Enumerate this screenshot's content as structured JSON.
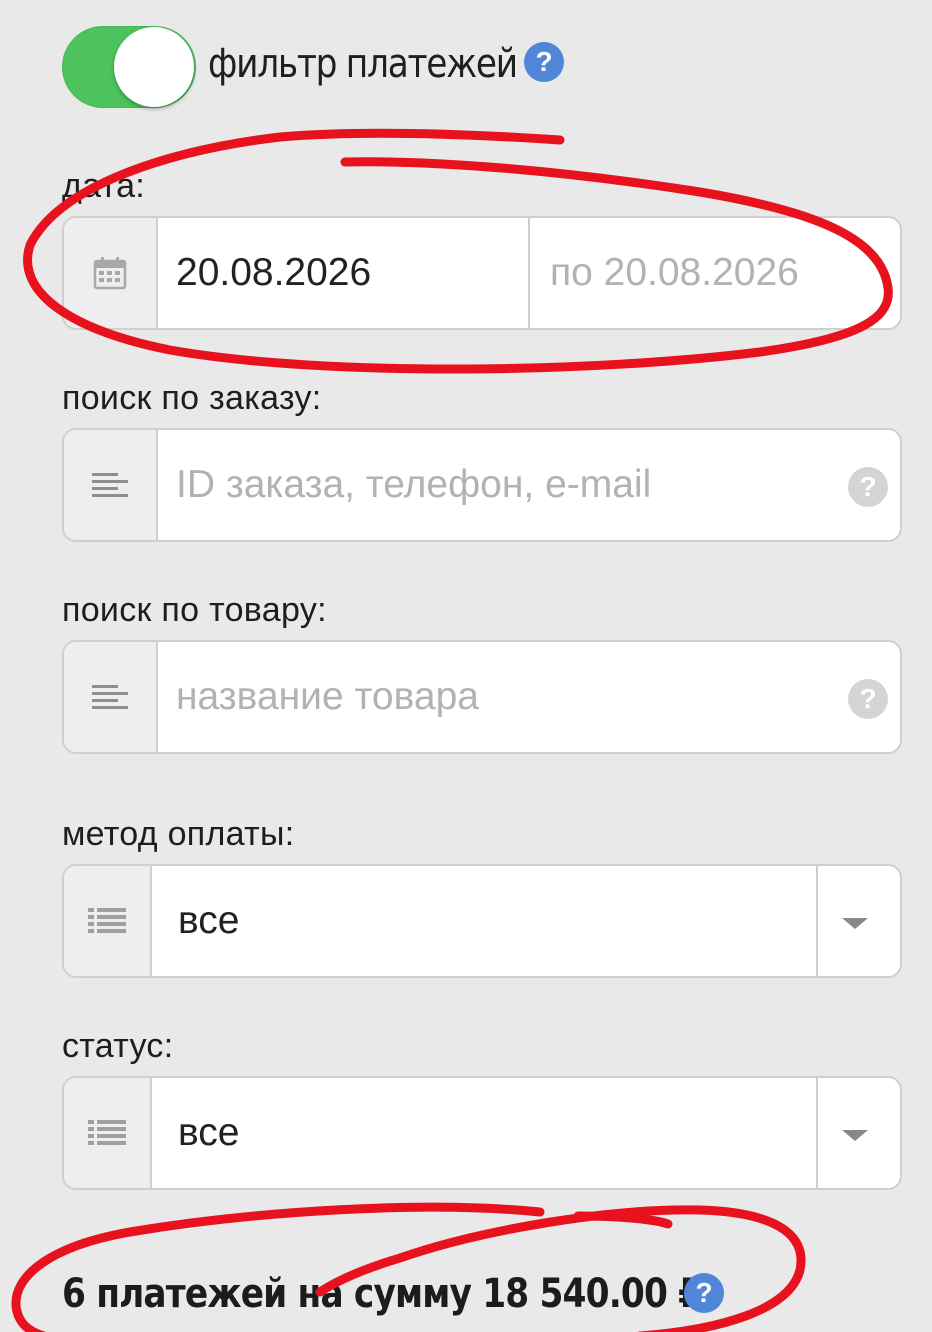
{
  "filter": {
    "title": "фильтр платежей",
    "enabled": true,
    "help_glyph": "?"
  },
  "date": {
    "label": "дата:",
    "icon": "calendar-icon",
    "from_value": "20.08.2026",
    "to_placeholder": "по 20.08.2026"
  },
  "order_search": {
    "label": "поиск по заказу:",
    "icon": "text-lines-icon",
    "placeholder": "ID заказа, телефон, e-mail",
    "help_glyph": "?"
  },
  "product_search": {
    "label": "поиск по товару:",
    "icon": "text-lines-icon",
    "placeholder": "название товара",
    "help_glyph": "?"
  },
  "payment_method": {
    "label": "метод оплаты:",
    "icon": "list-icon",
    "value": "все"
  },
  "status": {
    "label": "статус:",
    "icon": "list-icon",
    "value": "все"
  },
  "summary": {
    "text": "6 платежей на сумму 18 540.00 ₽",
    "help_glyph": "?"
  },
  "colors": {
    "toggle_on": "#4cc35c",
    "help_blue": "#4f86d8",
    "annotation_red": "#e8121e",
    "background": "#e9e9e9"
  }
}
